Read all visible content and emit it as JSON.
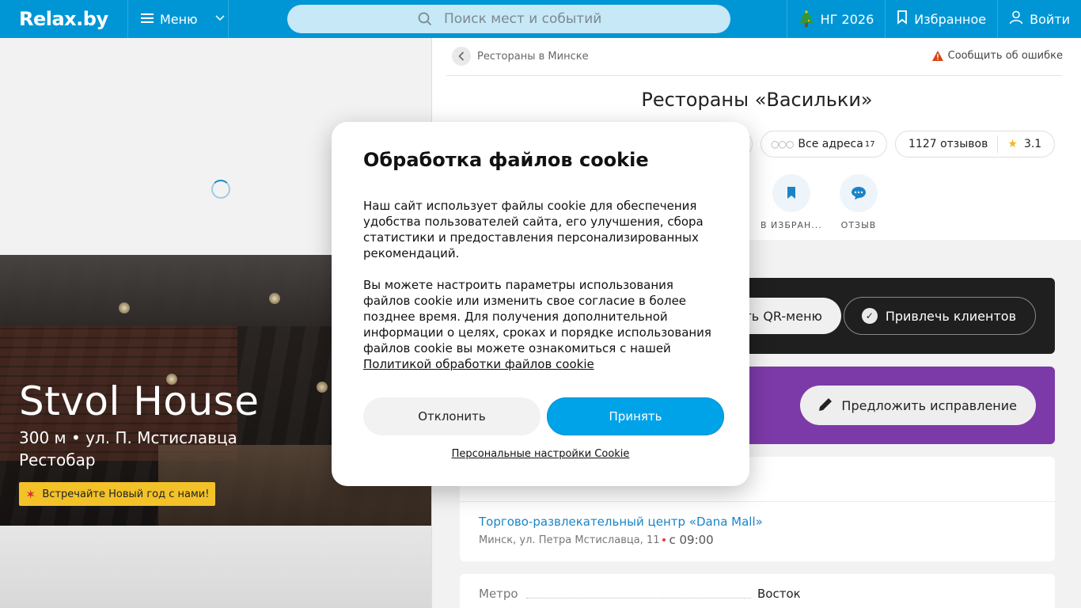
{
  "header": {
    "logo": "Relax.by",
    "menu_label": "Меню",
    "search_placeholder": "Поиск мест и событий",
    "ng_label": "НГ 2026",
    "favorites_label": "Избранное",
    "login_label": "Войти"
  },
  "hero": {
    "title": "Stvol House",
    "subtitle": "300 м • ул. П. Мстиславца",
    "category": "Рестобар",
    "promo": "Встречайте Новый год с нами!"
  },
  "place": {
    "breadcrumb": "Рестораны в Минске",
    "report_error": "Сообщить об ошибке",
    "title": "Рестораны «Васильки»",
    "all_addresses_label": "Все адреса",
    "all_addresses_count": "17",
    "reviews": "1127 отзывов",
    "rating": "3.1",
    "action_favorite": "В ИЗБРАН...",
    "action_review": "ОТЗЫВ",
    "qr_menu_label": "ть QR-меню",
    "attract_label": "Привлечь клиентов",
    "suggest_fix_label": "Предложить исправление",
    "mall_name": "Торгово-развлекательный центр «Dana Mall»",
    "address": "Минск, ул. Петра Мстиславца, 11",
    "open_time": "с 09:00",
    "metro_label": "Метро",
    "metro_value": "Восток"
  },
  "cookie": {
    "title": "Обработка файлов cookie",
    "paragraph1": "Наш сайт использует файлы cookie для обеспечения удобства пользователей сайта, его улучшения, сбора статистики и предоставления персонализированных рекомендаций.",
    "paragraph2": "Вы можете настроить параметры использования файлов cookie или изменить свое согласие в более позднее время. Для получения дополнительной информации о целях, сроках и порядке использования файлов cookie вы можете ознакомиться с нашей",
    "policy_link": "Политикой обработки файлов cookie",
    "decline": "Отклонить",
    "accept": "Принять",
    "personal_settings": "Персональные настройки Cookie"
  },
  "colors": {
    "header_bg": "#0096d6",
    "accept_bg": "#00a3e8",
    "promo_bg": "#f3c228",
    "purple_card": "#7c3aa8",
    "dark_card": "#1f1f1f"
  }
}
